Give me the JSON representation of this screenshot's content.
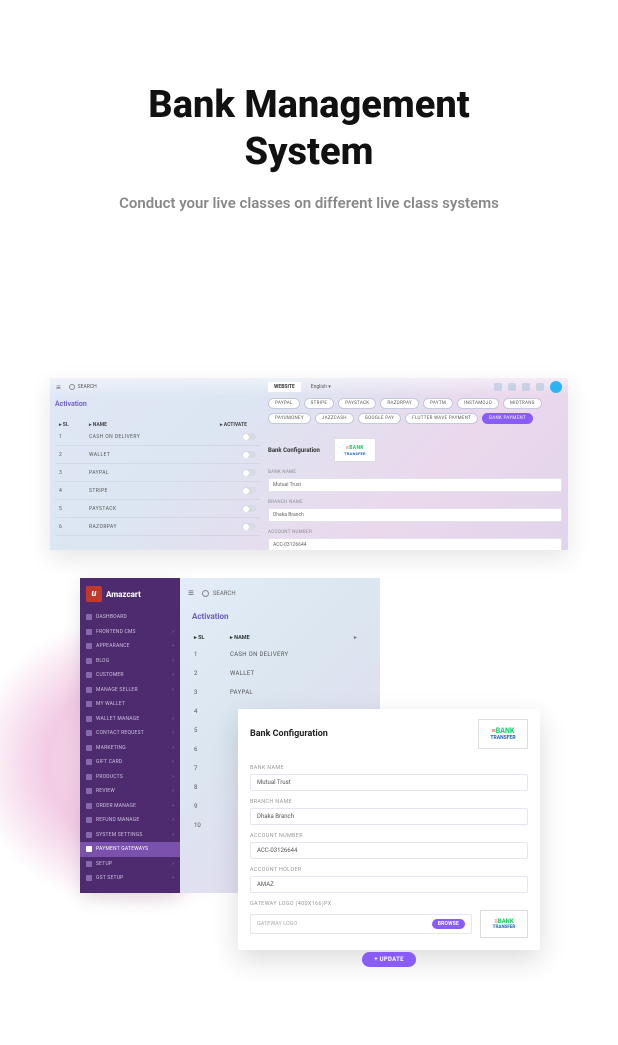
{
  "hero": {
    "title_line1": "Bank Management",
    "title_line2": "System",
    "subtitle": "Conduct your live classes on different live class systems"
  },
  "shot1": {
    "search": "SEARCH",
    "website_tab": "WEBSITE",
    "language": "English",
    "activation_title": "Activation",
    "cols": {
      "sl": "SL",
      "name": "NAME",
      "activate": "ACTIVATE"
    },
    "rows": [
      {
        "sl": "1",
        "name": "CASH ON DELIVERY"
      },
      {
        "sl": "2",
        "name": "WALLET"
      },
      {
        "sl": "3",
        "name": "PAYPAL"
      },
      {
        "sl": "4",
        "name": "STRIPE"
      },
      {
        "sl": "5",
        "name": "PAYSTACK"
      },
      {
        "sl": "6",
        "name": "RAZORPAY"
      }
    ],
    "gateways": [
      "PAYPAL",
      "STRIPE",
      "PAYSTACK",
      "RAZORPAY",
      "PAYTM",
      "INSTAMOJO",
      "MIDTRANS",
      "PAYUMONEY",
      "JAZZCASH",
      "GOOGLE PAY",
      "FLUTTER WAVE PAYMENT",
      "BANK PAYMENT"
    ],
    "gateway_active_idx": 11,
    "bank_config_title": "Bank Configuration",
    "logo_top": "BANK",
    "logo_bottom": "TRANSFER",
    "fields": [
      {
        "label": "BANK NAME",
        "value": "Mutual Trust"
      },
      {
        "label": "BRANCH NAME",
        "value": "Dhaka Branch"
      },
      {
        "label": "ACCOUNT NUMBER",
        "value": "ACC-03126644"
      }
    ]
  },
  "shot2": {
    "brand": "Amazcart",
    "search": "SEARCH",
    "activation_title": "Activation",
    "cols": {
      "sl": "SL",
      "name": "NAME"
    },
    "rows": [
      {
        "sl": "1",
        "name": "CASH ON DELIVERY"
      },
      {
        "sl": "2",
        "name": "WALLET"
      },
      {
        "sl": "3",
        "name": "PAYPAL"
      },
      {
        "sl": "4",
        "name": ""
      },
      {
        "sl": "5",
        "name": ""
      },
      {
        "sl": "6",
        "name": ""
      },
      {
        "sl": "7",
        "name": ""
      },
      {
        "sl": "8",
        "name": ""
      },
      {
        "sl": "9",
        "name": ""
      },
      {
        "sl": "10",
        "name": ""
      }
    ],
    "menu": [
      {
        "label": "DASHBOARD",
        "sub": false
      },
      {
        "label": "FRONTEND CMS",
        "sub": true
      },
      {
        "label": "APPEARANCE",
        "sub": true
      },
      {
        "label": "BLOG",
        "sub": true
      },
      {
        "label": "CUSTOMER",
        "sub": true
      },
      {
        "label": "MANAGE SELLER",
        "sub": true
      },
      {
        "label": "MY WALLET",
        "sub": false
      },
      {
        "label": "WALLET MANAGE",
        "sub": true
      },
      {
        "label": "CONTACT REQUEST",
        "sub": true
      },
      {
        "label": "MARKETING",
        "sub": true
      },
      {
        "label": "GIFT CARD",
        "sub": true
      },
      {
        "label": "PRODUCTS",
        "sub": true
      },
      {
        "label": "REVIEW",
        "sub": true
      },
      {
        "label": "ORDER MANAGE",
        "sub": true
      },
      {
        "label": "REFUND MANAGE",
        "sub": true
      },
      {
        "label": "SYSTEM SETTINGS",
        "sub": true
      },
      {
        "label": "PAYMENT GATEWAYS",
        "sub": false,
        "active": true
      },
      {
        "label": "SETUP",
        "sub": true
      },
      {
        "label": "GST SETUP",
        "sub": true
      }
    ]
  },
  "shot3": {
    "title": "Bank Configuration",
    "logo_top": "BANK",
    "logo_bottom": "TRANSFER",
    "fields": [
      {
        "label": "BANK NAME",
        "value": "Mutual Trust"
      },
      {
        "label": "BRANCH NAME",
        "value": "Dhaka Branch"
      },
      {
        "label": "ACCOUNT NUMBER",
        "value": "ACC-03126644"
      },
      {
        "label": "ACCOUNT HOLDER",
        "value": "AMAZ"
      }
    ],
    "logo_field_label": "GATEWAY LOGO (400X166)PX",
    "logo_placeholder": "GATEWAY LOGO",
    "browse_btn": "BROWSE",
    "update_btn": "+ UPDATE"
  }
}
